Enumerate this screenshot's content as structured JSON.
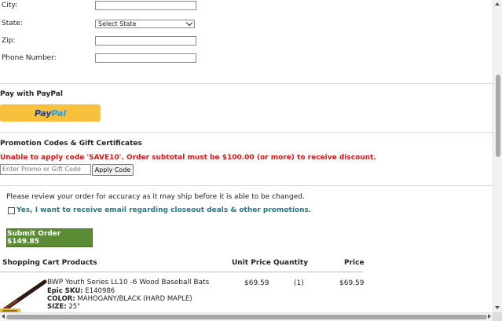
{
  "address_form": {
    "city_label": "City:",
    "state_label": "State:",
    "state_selected": "Select State",
    "zip_label": "Zip:",
    "phone_label": "Phone Number:"
  },
  "paypal": {
    "title": "Pay with PayPal",
    "brand_part1": "Pay",
    "brand_part2": "Pal",
    "button_color": "#f7c13e"
  },
  "promo": {
    "title": "Promotion Codes & Gift Certificates",
    "error": "Unable to apply code 'SAVE10'. Order subtotal must be $100.00 (or more) to receive discount.",
    "input_placeholder": "Enter Promo or Gift Code",
    "apply_label": "Apply Code",
    "error_color": "#d61a1a"
  },
  "review": {
    "notice": "Please review your order for accuracy as it may ship before it is able to be changed.",
    "email_opt_in": "Yes, I want to receive email regarding closeout deals & other promotions.",
    "email_opt_in_checked": false,
    "submit_label": "Submit Order $149.85",
    "submit_color": "#5b8c33"
  },
  "cart": {
    "headers": {
      "products": "Shopping Cart Products",
      "unit_price": "Unit Price",
      "quantity": "Quantity",
      "price": "Price"
    },
    "items": [
      {
        "name": "BWP Youth Series LL10 -6 Wood Baseball Bats",
        "sku_label": "Epic SKU:",
        "sku": "E140986",
        "color_label": "COLOR:",
        "color": "MAHOGANY/BLACK (HARD MAPLE)",
        "size_label": "SIZE:",
        "size": "25\"",
        "unit_price": "$69.59",
        "quantity": "(1)",
        "price": "$69.59",
        "image": "baseball-bat"
      }
    ]
  }
}
